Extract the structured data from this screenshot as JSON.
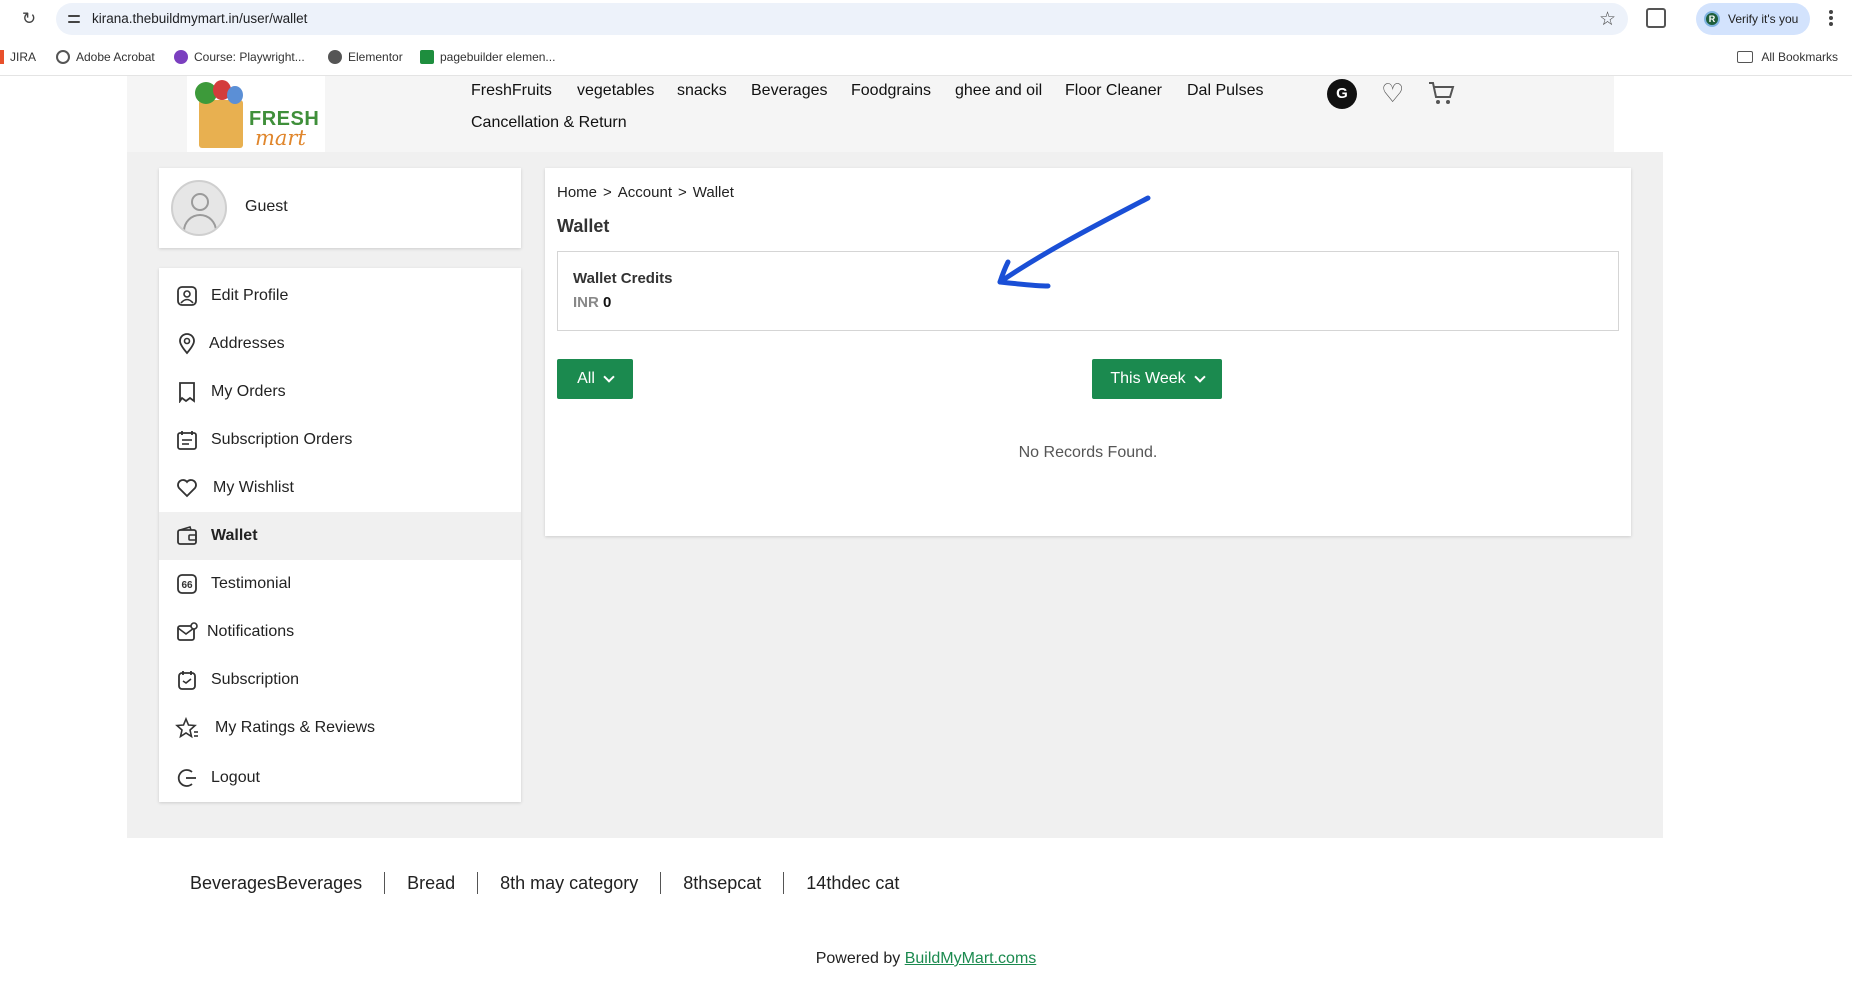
{
  "browser": {
    "url": "kirana.thebuildmymart.in/user/wallet",
    "profile_chip": "Verify it's you",
    "profile_initial": "R",
    "bookmarks": [
      {
        "label": "JIRA",
        "icon": "jira-icon",
        "color": "#e8502b"
      },
      {
        "label": "Adobe Acrobat",
        "icon": "acrobat-icon",
        "color": "#555555"
      },
      {
        "label": "Course: Playwright...",
        "icon": "course-icon",
        "color": "#7b3fbf"
      },
      {
        "label": "Elementor",
        "icon": "elementor-icon",
        "color": "#555555"
      },
      {
        "label": "pagebuilder elemen...",
        "icon": "sheets-icon",
        "color": "#1e8e3e"
      }
    ],
    "all_bookmarks": "All Bookmarks"
  },
  "header": {
    "logo_text_1": "FRESH",
    "logo_text_2": "mart",
    "categories": [
      "FreshFruits",
      "vegetables",
      "snacks",
      "Beverages",
      "Foodgrains",
      "ghee and oil",
      "Floor Cleaner",
      "Dal Pulses",
      "Cancellation & Return"
    ],
    "avatar_initial": "G"
  },
  "sidebar": {
    "user_name": "Guest",
    "items": [
      {
        "label": "Edit Profile",
        "icon": "user-card-icon"
      },
      {
        "label": "Addresses",
        "icon": "location-pin-icon"
      },
      {
        "label": "My Orders",
        "icon": "receipt-icon"
      },
      {
        "label": "Subscription Orders",
        "icon": "calendar-list-icon"
      },
      {
        "label": "My Wishlist",
        "icon": "heart-icon"
      },
      {
        "label": "Wallet",
        "icon": "wallet-icon",
        "active": true
      },
      {
        "label": "Testimonial",
        "icon": "quote-icon"
      },
      {
        "label": "Notifications",
        "icon": "mail-notification-icon"
      },
      {
        "label": "Subscription",
        "icon": "subscription-icon"
      },
      {
        "label": "My Ratings & Reviews",
        "icon": "star-rating-icon"
      },
      {
        "label": "Logout",
        "icon": "logout-icon"
      }
    ]
  },
  "main": {
    "breadcrumb": [
      "Home",
      "Account",
      "Wallet"
    ],
    "breadcrumb_sep": ">",
    "title": "Wallet",
    "credits_label": "Wallet Credits",
    "credits_currency": "INR",
    "credits_amount": "0",
    "filter_type": "All",
    "filter_period": "This Week",
    "empty_message": "No Records Found.",
    "accent_color": "#1b8a4f"
  },
  "footer": {
    "categories": [
      "BeveragesBeverages",
      "Bread",
      "8th may category",
      "8thsepcat",
      "14thdec cat"
    ],
    "powered_prefix": "Powered by",
    "powered_link": "BuildMyMart.coms"
  }
}
